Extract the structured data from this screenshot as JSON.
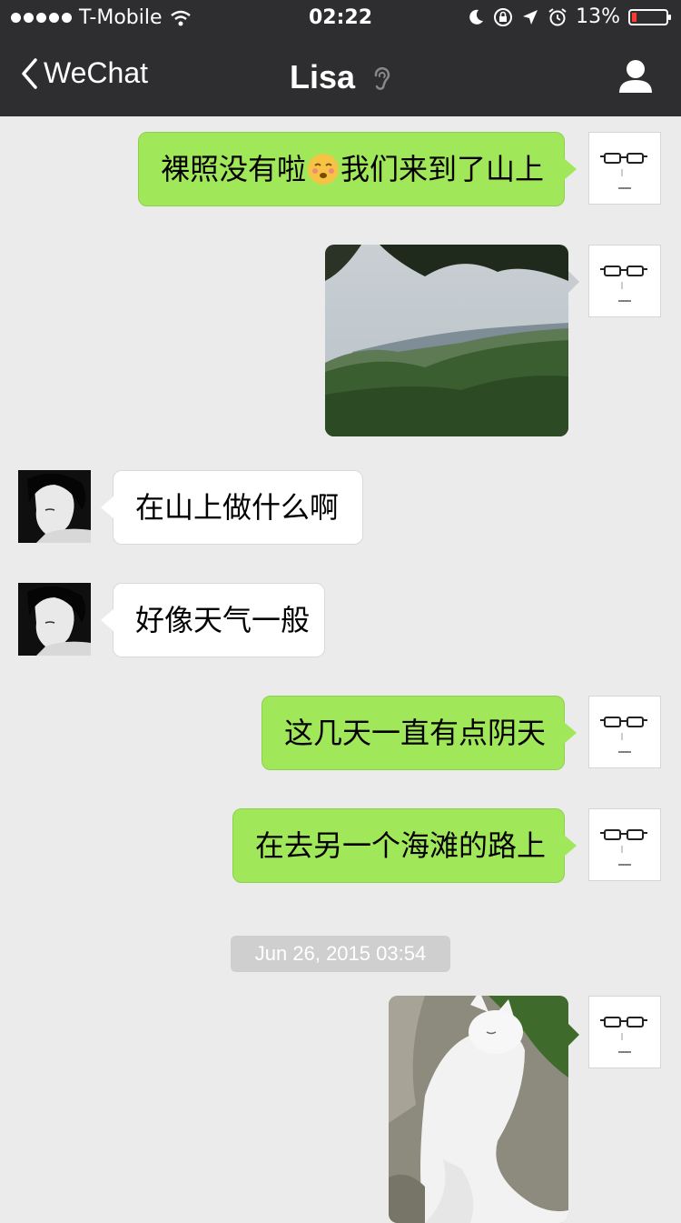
{
  "status_bar": {
    "carrier": "T-Mobile",
    "time": "02:22",
    "battery_percent": "13%",
    "battery_level": 0.13
  },
  "nav": {
    "back_label": "WeChat",
    "title": "Lisa"
  },
  "messages": [
    {
      "direction": "out",
      "type": "text",
      "text_before": "裸照没有啦",
      "emoji": "face-emoji",
      "text_after": "我们来到了山上"
    },
    {
      "direction": "out",
      "type": "image",
      "image": "mountain-landscape-photo"
    },
    {
      "direction": "in",
      "type": "text",
      "text": "在山上做什么啊"
    },
    {
      "direction": "in",
      "type": "text",
      "text": "好像天气一般"
    },
    {
      "direction": "out",
      "type": "text",
      "text": "这几天一直有点阴天"
    },
    {
      "direction": "out",
      "type": "text",
      "text": "在去另一个海滩的路上"
    },
    {
      "direction": "out",
      "type": "image",
      "image": "white-cat-photo"
    }
  ],
  "timestamp": "Jun 26, 2015 03:54",
  "colors": {
    "nav_background": "#2e2e30",
    "chat_background": "#ebebeb",
    "outgoing_bubble": "#a0e75a",
    "incoming_bubble": "#ffffff",
    "battery_low": "#ff3b30"
  }
}
